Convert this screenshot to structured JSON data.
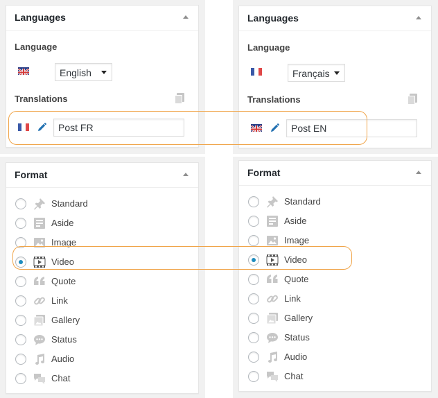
{
  "panels": [
    {
      "languages": {
        "title": "Languages",
        "language_label": "Language",
        "selected_language": "English",
        "current_flag": "flag-en",
        "translations_label": "Translations",
        "translation": {
          "flag": "flag-fr",
          "value": "Post FR"
        }
      },
      "format": {
        "title": "Format",
        "selected": "Video",
        "options": [
          {
            "label": "Standard",
            "icon": "pin-icon"
          },
          {
            "label": "Aside",
            "icon": "aside-icon"
          },
          {
            "label": "Image",
            "icon": "image-icon"
          },
          {
            "label": "Video",
            "icon": "video-icon"
          },
          {
            "label": "Quote",
            "icon": "quote-icon"
          },
          {
            "label": "Link",
            "icon": "link-icon"
          },
          {
            "label": "Gallery",
            "icon": "gallery-icon"
          },
          {
            "label": "Status",
            "icon": "status-icon"
          },
          {
            "label": "Audio",
            "icon": "audio-icon"
          },
          {
            "label": "Chat",
            "icon": "chat-icon"
          }
        ]
      }
    },
    {
      "languages": {
        "title": "Languages",
        "language_label": "Language",
        "selected_language": "Français",
        "current_flag": "flag-fr",
        "translations_label": "Translations",
        "translation": {
          "flag": "flag-en",
          "value": "Post EN"
        }
      },
      "format": {
        "title": "Format",
        "selected": "Video",
        "options": [
          {
            "label": "Standard",
            "icon": "pin-icon"
          },
          {
            "label": "Aside",
            "icon": "aside-icon"
          },
          {
            "label": "Image",
            "icon": "image-icon"
          },
          {
            "label": "Video",
            "icon": "video-icon"
          },
          {
            "label": "Quote",
            "icon": "quote-icon"
          },
          {
            "label": "Link",
            "icon": "link-icon"
          },
          {
            "label": "Gallery",
            "icon": "gallery-icon"
          },
          {
            "label": "Status",
            "icon": "status-icon"
          },
          {
            "label": "Audio",
            "icon": "audio-icon"
          },
          {
            "label": "Chat",
            "icon": "chat-icon"
          }
        ]
      }
    }
  ],
  "colors": {
    "highlight": "#f0a54a",
    "radio_checked": "#1e8cbe",
    "pencil": "#2271b1",
    "icon_gray": "#c7c7c7"
  }
}
